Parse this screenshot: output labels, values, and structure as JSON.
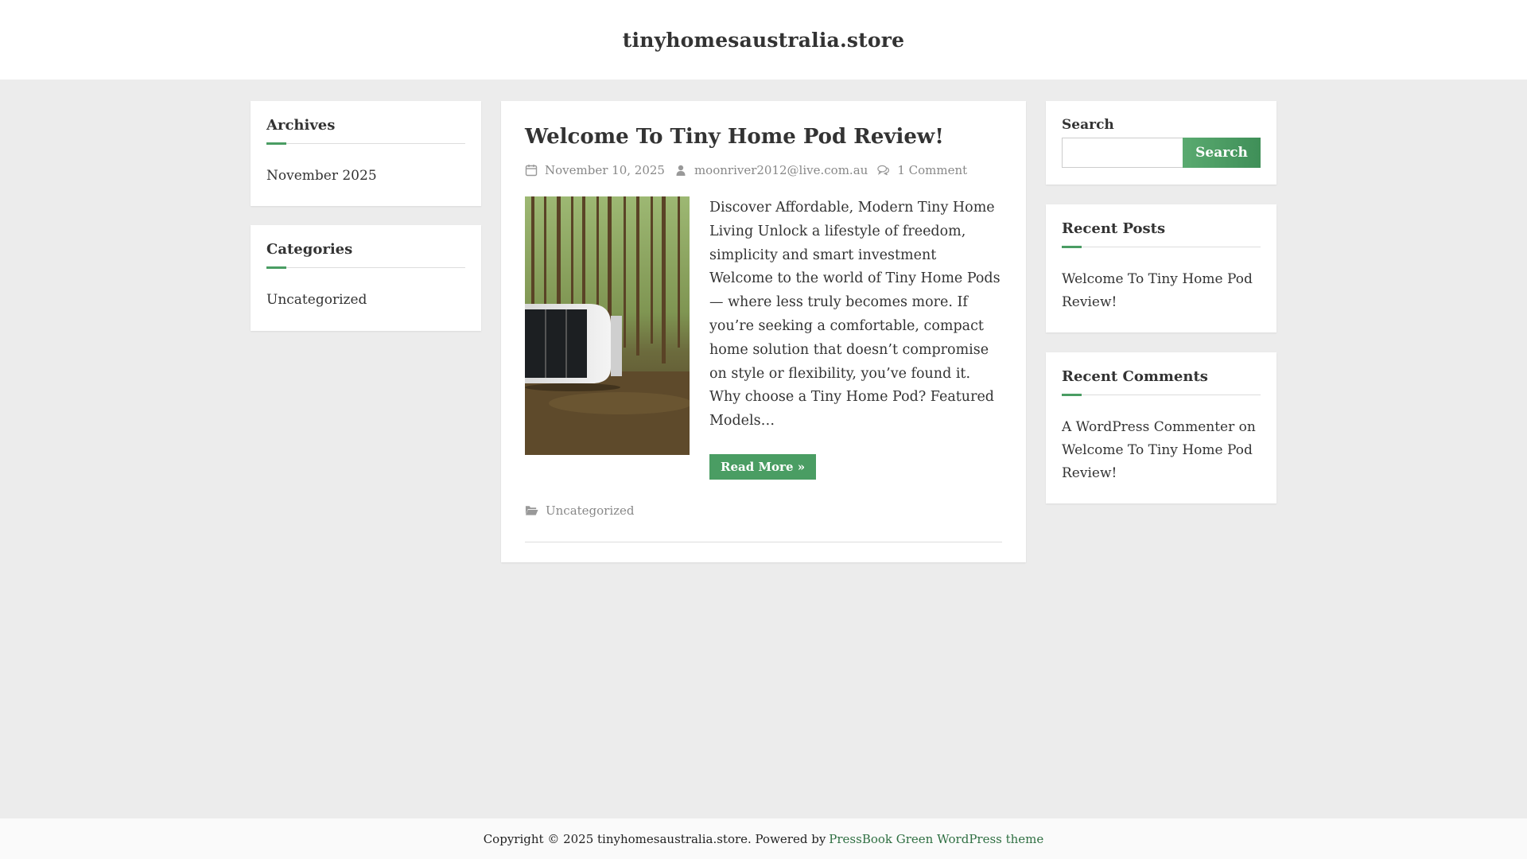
{
  "site": {
    "title": "tinyhomesaustralia.store"
  },
  "left_sidebar": {
    "archives": {
      "title": "Archives",
      "items": [
        "November 2025"
      ]
    },
    "categories": {
      "title": "Categories",
      "items": [
        "Uncategorized"
      ]
    }
  },
  "post": {
    "title": "Welcome To Tiny Home Pod Review!",
    "date": "November 10, 2025",
    "author": "moonriver2012@live.com.au",
    "comments": "1 Comment",
    "excerpt": "Discover Affordable, Modern Tiny Home Living Unlock a lifestyle of freedom, simplicity and smart investment Welcome to the world of Tiny Home Pods — where less truly becomes more. If you’re seeking a comfortable, compact home solution that doesn’t compromise on style or flexibility, you’ve found it. Why choose a Tiny Home Pod? Featured Models…",
    "read_more": "Read More »",
    "category": "Uncategorized"
  },
  "right_sidebar": {
    "search": {
      "title": "Search",
      "placeholder": "",
      "button": "Search"
    },
    "recent_posts": {
      "title": "Recent Posts",
      "items": [
        "Welcome To Tiny Home Pod Review!"
      ]
    },
    "recent_comments": {
      "title": "Recent Comments",
      "author": "A WordPress Commenter",
      "on": "on",
      "post": "Welcome To Tiny Home Pod Review!"
    }
  },
  "footer": {
    "text": "Copyright © 2025 tinyhomesaustralia.store. Powered by",
    "link": "PressBook Green WordPress theme"
  },
  "colors": {
    "accent": "#4a9d63",
    "background": "#ececec",
    "footer_link": "#2f6f42"
  },
  "icons": {
    "date": "calendar-icon",
    "author": "user-icon",
    "comments": "comments-icon",
    "category": "folder-icon"
  }
}
